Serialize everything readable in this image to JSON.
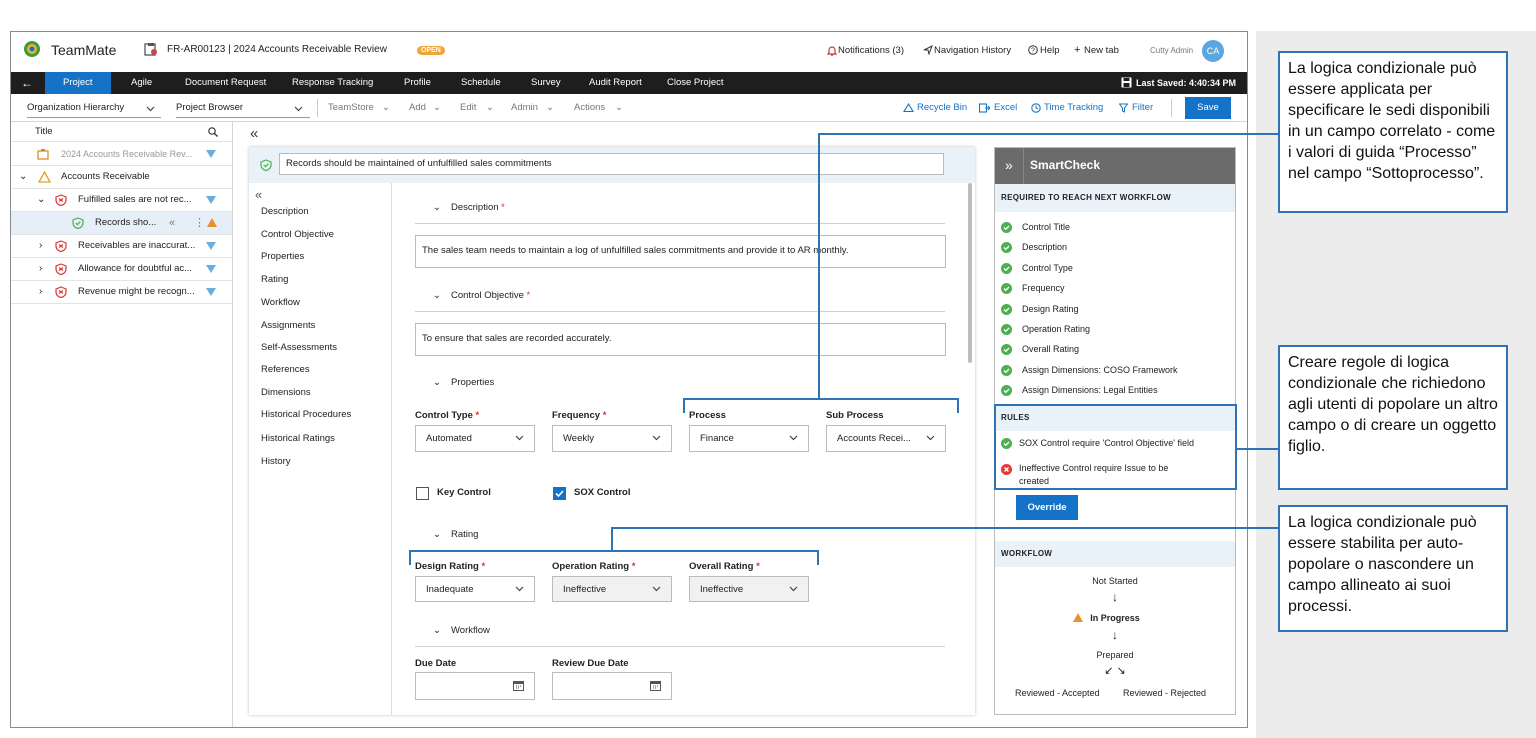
{
  "app": {
    "name": "TeamMate",
    "record_id_title": "FR-AR00123 | 2024 Accounts Receivable Review",
    "status_badge": "OPEN"
  },
  "topbar": {
    "notifications": "Notifications (3)",
    "nav_history": "Navigation History",
    "help": "Help",
    "new_tab": "New tab",
    "user_name": "Cutty Admin",
    "avatar_initials": "CA"
  },
  "navbar": {
    "tabs": [
      "Project",
      "Agile",
      "Document Request",
      "Response Tracking",
      "Profile",
      "Schedule",
      "Survey",
      "Audit Report",
      "Close Project"
    ],
    "last_saved": "Last Saved: 4:40:34 PM"
  },
  "toolbar": {
    "org_hierarchy": "Organization Hierarchy",
    "project_browser": "Project Browser",
    "menus": [
      "TeamStore",
      "Add",
      "Edit",
      "Admin",
      "Actions"
    ],
    "recycle_bin": "Recycle Bin",
    "excel": "Excel",
    "time_tracking": "Time Tracking",
    "filter": "Filter",
    "save": "Save"
  },
  "tree": {
    "header": "Title",
    "rows": [
      {
        "label": "2024 Accounts Receivable Rev..."
      },
      {
        "label": "Accounts Receivable"
      },
      {
        "label": "Fulfilled sales are not rec..."
      },
      {
        "label": "Records sho..."
      },
      {
        "label": "Receivables are inaccurat..."
      },
      {
        "label": "Allowance for doubtful ac..."
      },
      {
        "label": "Revenue might be recogn..."
      }
    ]
  },
  "control": {
    "title": "Records should be maintained of unfulfilled sales commitments"
  },
  "section_nav": [
    "Description",
    "Control Objective",
    "Properties",
    "Rating",
    "Workflow",
    "Assignments",
    "Self-Assessments",
    "References",
    "Dimensions",
    "Historical Procedures",
    "Historical Ratings",
    "History"
  ],
  "form": {
    "description_header": "Description",
    "description_text": "The sales team needs to maintain a log of unfulfilled sales commitments and provide it to AR monthly.",
    "objective_header": "Control Objective",
    "objective_text": "To ensure that sales are recorded accurately.",
    "properties_header": "Properties",
    "control_type_label": "Control Type",
    "control_type_value": "Automated",
    "frequency_label": "Frequency",
    "frequency_value": "Weekly",
    "process_label": "Process",
    "process_value": "Finance",
    "subprocess_label": "Sub Process",
    "subprocess_value": "Accounts Recei...",
    "key_control_label": "Key Control",
    "key_control_checked": false,
    "sox_control_label": "SOX Control",
    "sox_control_checked": true,
    "rating_header": "Rating",
    "design_rating_label": "Design Rating",
    "design_rating_value": "Inadequate",
    "operation_rating_label": "Operation Rating",
    "operation_rating_value": "Ineffective",
    "overall_rating_label": "Overall Rating",
    "overall_rating_value": "Ineffective",
    "workflow_header": "Workflow",
    "due_date_label": "Due Date",
    "review_due_date_label": "Review Due Date"
  },
  "smartcheck": {
    "title": "SmartCheck",
    "required_header": "REQUIRED TO REACH NEXT WORKFLOW",
    "required_items": [
      "Control Title",
      "Description",
      "Control Type",
      "Frequency",
      "Design Rating",
      "Operation Rating",
      "Overall Rating",
      "Assign Dimensions: COSO Framework",
      "Assign Dimensions: Legal Entities"
    ],
    "rules_header": "RULES",
    "rules": [
      {
        "text": "SOX Control require 'Control Objective' field",
        "status": "pass"
      },
      {
        "text_line1": "Ineffective Control require Issue to be",
        "text_line2": "created",
        "status": "fail"
      }
    ],
    "override": "Override",
    "workflow_header": "WORKFLOW",
    "workflow_steps": [
      "Not Started",
      "In Progress",
      "Prepared",
      "Reviewed - Accepted",
      "Reviewed - Rejected"
    ]
  },
  "callouts": {
    "top": "La logica condizionale può essere applicata per specificare le sedi disponibili in un campo correlato - come i valori di guida “Processo” nel campo “Sottoprocesso”.",
    "middle": "Creare regole di logica condizionale che richiedono agli utenti di popolare un altro campo o di creare un oggetto figlio.",
    "bottom": "La logica condizionale può essere stabilita per auto-popolare o nascondere un campo allineato ai suoi processi."
  },
  "colors": {
    "accent": "#1473c6",
    "navbar": "#1e1e1e",
    "callout_border": "#2e74b5",
    "badge": "#f2a33a",
    "pass": "#4caf50",
    "fail": "#e53935"
  }
}
